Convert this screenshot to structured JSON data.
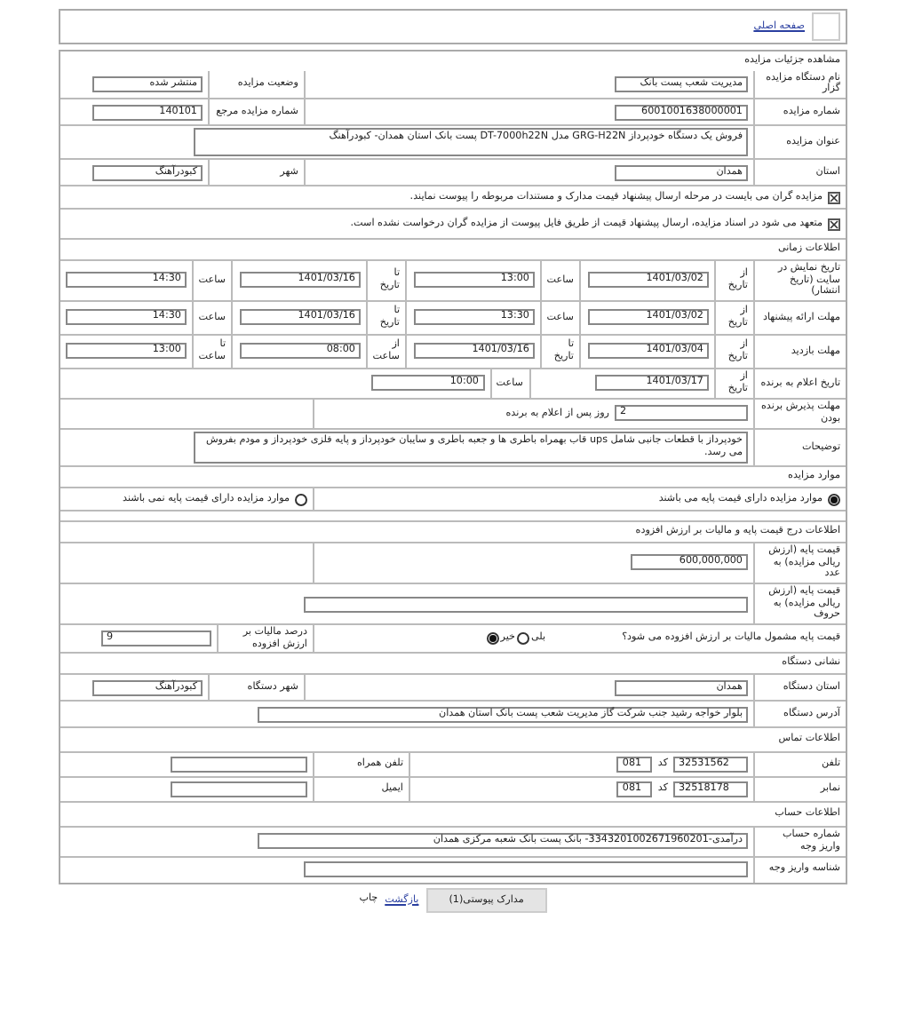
{
  "header": {
    "link": "صفحه اصلی"
  },
  "title": "مشاهده جزئیات مزایده",
  "rows": [
    {
      "kind": "pair",
      "label": "نام دستگاه مزایده گزار",
      "value": "مدیریت شعب پست بانک",
      "label2": "وضعیت مزایده",
      "value2": "منتشر شده"
    },
    {
      "kind": "pair",
      "label": "شماره مزایده",
      "value": "6001001638000001",
      "label2": "شماره مزایده مرجع",
      "value2": "140101"
    },
    {
      "kind": "area",
      "label": "عنوان مزایده",
      "value": "فروش یک دستگاه خودپرداز GRG-H22N مدل DT-7000h22N پست بانک استان همدان- کبودرآهنگ"
    },
    {
      "kind": "pair",
      "label": "استان",
      "value": "همدان",
      "label2": "شهر",
      "value2": "کبودرآهنگ"
    },
    {
      "kind": "check",
      "checked": true,
      "text": "مزایده گران می بایست در مرحله ارسال پیشنهاد قیمت مدارک و مستندات مربوطه را پیوست نمایند."
    },
    {
      "kind": "check",
      "checked": true,
      "text": "متعهد می شود در اسناد مزایده، ارسال پیشنهاد قیمت از طریق فایل پیوست از مزایده گران درخواست نشده است."
    },
    {
      "kind": "heading",
      "text": "اطلاعات زمانی"
    },
    {
      "kind": "dates",
      "label": "تاریخ نمایش در سایت (تاریخ انتشار)",
      "cells": [
        {
          "caption": "از تاریخ",
          "value": "1401/03/02"
        },
        {
          "caption": "ساعت",
          "value": "13:00"
        },
        {
          "caption": "تا تاریخ",
          "value": "1401/03/16"
        },
        {
          "caption": "ساعت",
          "value": "14:30"
        }
      ]
    },
    {
      "kind": "dates",
      "label": "مهلت ارائه پیشنهاد",
      "cells": [
        {
          "caption": "از تاریخ",
          "value": "1401/03/02"
        },
        {
          "caption": "ساعت",
          "value": "13:30"
        },
        {
          "caption": "تا تاریخ",
          "value": "1401/03/16"
        },
        {
          "caption": "ساعت",
          "value": "14:30"
        }
      ]
    },
    {
      "kind": "dates",
      "label": "مهلت بازدید",
      "cells": [
        {
          "caption": "از تاریخ",
          "value": "1401/03/04"
        },
        {
          "caption": "تا تاریخ",
          "value": "1401/03/16"
        },
        {
          "caption": "از ساعت",
          "value": "08:00"
        },
        {
          "caption": "تا ساعت",
          "value": "13:00"
        }
      ]
    },
    {
      "kind": "dates",
      "label": "تاریخ اعلام به برنده",
      "cells": [
        {
          "caption": "از تاریخ",
          "value": "1401/03/17"
        },
        {
          "caption": "ساعت",
          "value": "10:00"
        }
      ]
    },
    {
      "kind": "days",
      "label": "مهلت پذیرش برنده بودن",
      "value": "2",
      "suffix": "روز پس از اعلام به برنده"
    },
    {
      "kind": "area",
      "label": "توضیحات",
      "value": "خودپرداز با قطعات جانبی شامل ups قاب بهمراه باطری ها و جعبه باطری و سایبان خودپرداز و پایه فلزی خودپرداز و مودم بفروش می رسد."
    },
    {
      "kind": "heading",
      "text": "موارد مزایده"
    },
    {
      "kind": "radios",
      "options": [
        {
          "label": "موارد مزایده دارای قیمت پایه می باشند",
          "selected": true
        },
        {
          "label": "موارد مزایده دارای قیمت پایه نمی باشند",
          "selected": false
        }
      ]
    },
    {
      "kind": "blank"
    },
    {
      "kind": "heading",
      "text": "اطلاعات درج قیمت پایه و مالیات بر ارزش افزوده"
    },
    {
      "kind": "field",
      "label": "قیمت پایه (ارزش ریالی مزایده) به عدد",
      "value": "600,000,000"
    },
    {
      "kind": "wide_field",
      "label": "قیمت پایه (ارزش ریالی مزایده) به حروف"
    },
    {
      "kind": "vat",
      "question": "قیمت پایه مشمول مالیات بر ارزش افزوده می شود؟",
      "options": [
        {
          "label": "بلی",
          "selected": false
        },
        {
          "label": "خیر",
          "selected": true
        }
      ],
      "label2": "درصد مالیات بر ارزش افزوده",
      "value2": "9"
    },
    {
      "kind": "heading",
      "text": "نشانی دستگاه"
    },
    {
      "kind": "pair",
      "label": "استان دستگاه",
      "value": "همدان",
      "label2": "شهر دستگاه",
      "value2": "کبودرآهنگ"
    },
    {
      "kind": "wide_field",
      "label": "آدرس دستگاه",
      "value": "بلوار خواجه رشید جنب شرکت گاز مدیریت شعب پست بانک استان همدان"
    },
    {
      "kind": "heading",
      "text": "اطلاعات تماس"
    },
    {
      "kind": "phone",
      "label": "تلفن",
      "value": "32531562",
      "code_label": "کد",
      "code": "081",
      "label2": "تلفن همراه"
    },
    {
      "kind": "phone",
      "label": "نمابر",
      "value": "32518178",
      "code_label": "کد",
      "code": "081",
      "label2": "ایمیل"
    },
    {
      "kind": "heading",
      "text": "اطلاعات حساب"
    },
    {
      "kind": "wide_field",
      "label": "شماره حساب واریز وجه",
      "value": "درآمدی-3343201002671960201- بانک پست بانک شعبه مرکزی همدان"
    },
    {
      "kind": "wide_field",
      "label": "شناسه واریز وجه"
    }
  ],
  "footer": {
    "button": "مدارک پیوستی(1)",
    "link": "بازگشت",
    "text": "چاپ"
  }
}
